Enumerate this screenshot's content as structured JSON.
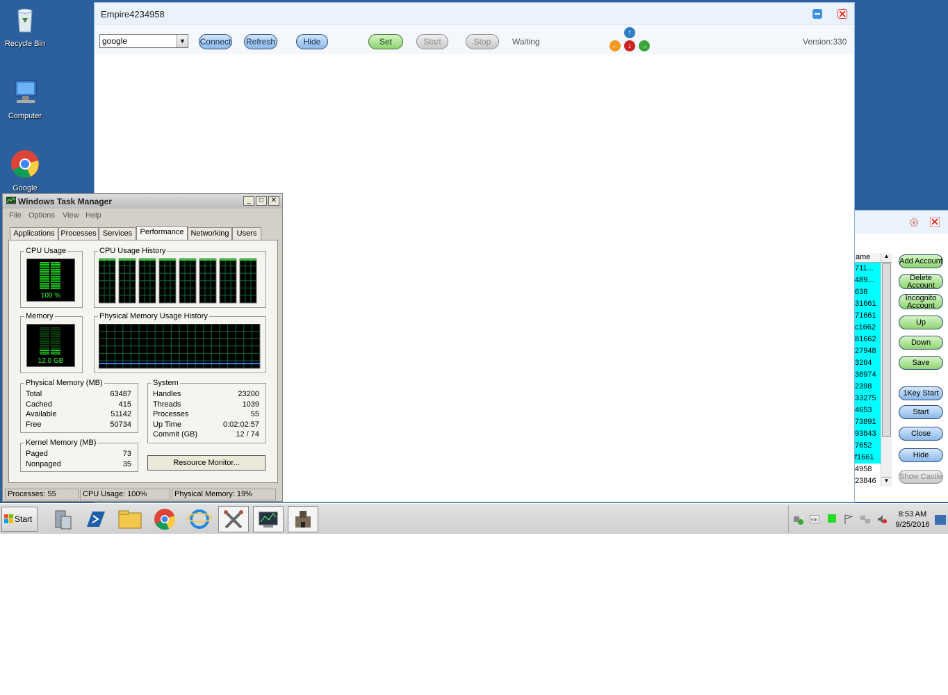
{
  "desktop": {
    "icons": [
      {
        "label": "Recycle Bin",
        "icon": "recycle-bin-icon"
      },
      {
        "label": "Computer",
        "icon": "computer-icon"
      },
      {
        "label": "Google",
        "icon": "chrome-icon"
      }
    ]
  },
  "empire": {
    "title": "Empire4234958",
    "combo_value": "google",
    "buttons": {
      "connect": "Connect",
      "refresh": "Refresh",
      "hide": "Hide",
      "set": "Set",
      "start": "Start",
      "stop": "Stop"
    },
    "status": "Waiting",
    "version": "Version:330",
    "colors": {
      "accent_blue": "#8bb9ea",
      "accent_green": "#8ed470"
    }
  },
  "accounts": {
    "column_header": "ame",
    "rows": [
      {
        "text": "711...",
        "selected": true
      },
      {
        "text": "489...",
        "selected": true
      },
      {
        "text": "638",
        "selected": true
      },
      {
        "text": "31661",
        "selected": true
      },
      {
        "text": "71661",
        "selected": true
      },
      {
        "text": "c1662",
        "selected": true
      },
      {
        "text": "81662",
        "selected": true
      },
      {
        "text": "27948",
        "selected": true
      },
      {
        "text": "3264",
        "selected": true
      },
      {
        "text": "38974",
        "selected": true
      },
      {
        "text": "2398",
        "selected": true
      },
      {
        "text": "33275",
        "selected": true
      },
      {
        "text": "4653",
        "selected": true
      },
      {
        "text": "73891",
        "selected": true
      },
      {
        "text": "93843",
        "selected": true
      },
      {
        "text": "7652",
        "selected": true
      },
      {
        "text": "f1661",
        "selected": true
      },
      {
        "text": "4958",
        "selected": false
      },
      {
        "text": "23846",
        "selected": false
      }
    ],
    "buttons": {
      "add": "Add Account",
      "delete": "Delete Account",
      "incognito": "Incognito Account",
      "up": "Up",
      "down": "Down",
      "save": "Save",
      "onekey": "1Key Start",
      "start": "Start",
      "close": "Close",
      "hide": "Hide",
      "show_castle": "Show Castle"
    }
  },
  "taskmanager": {
    "title": "Windows Task Manager",
    "menu": [
      "File",
      "Options",
      "View",
      "Help"
    ],
    "tabs": [
      "Applications",
      "Processes",
      "Services",
      "Performance",
      "Networking",
      "Users"
    ],
    "active_tab": "Performance",
    "cpu_usage_label": "CPU Usage",
    "cpu_usage_value": "100 %",
    "cpu_history_label": "CPU Usage History",
    "memory_label": "Memory",
    "memory_value": "12.0 GB",
    "mem_history_label": "Physical Memory Usage History",
    "physical": {
      "label": "Physical Memory (MB)",
      "rows": [
        {
          "k": "Total",
          "v": "63487"
        },
        {
          "k": "Cached",
          "v": "415"
        },
        {
          "k": "Available",
          "v": "51142"
        },
        {
          "k": "Free",
          "v": "50734"
        }
      ]
    },
    "system": {
      "label": "System",
      "rows": [
        {
          "k": "Handles",
          "v": "23200"
        },
        {
          "k": "Threads",
          "v": "1039"
        },
        {
          "k": "Processes",
          "v": "55"
        },
        {
          "k": "Up Time",
          "v": "0:02:02:57"
        },
        {
          "k": "Commit (GB)",
          "v": "12 / 74"
        }
      ]
    },
    "kernel": {
      "label": "Kernel Memory (MB)",
      "rows": [
        {
          "k": "Paged",
          "v": "73"
        },
        {
          "k": "Nonpaged",
          "v": "35"
        }
      ]
    },
    "resource_monitor": "Resource Monitor...",
    "statusbar": {
      "processes": "Processes: 55",
      "cpu": "CPU Usage: 100%",
      "memory": "Physical Memory: 19%"
    },
    "cpu_fraction": 1.0,
    "memory_fraction": 0.19
  },
  "taskbar": {
    "start_label": "Start",
    "time": "8:53 AM",
    "date": "9/25/2016",
    "apps": [
      "server-manager-icon",
      "powershell-icon",
      "explorer-folder-icon",
      "chrome-icon",
      "internet-explorer-icon",
      "tools-icon",
      "task-manager-icon",
      "castle-game-icon"
    ]
  }
}
